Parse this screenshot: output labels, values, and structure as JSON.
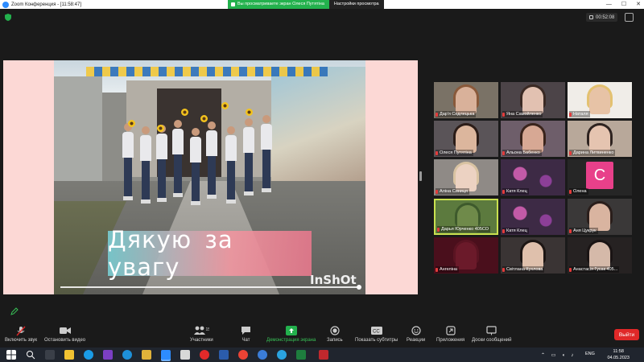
{
  "window": {
    "title": "Zoom Конференция - [11:58:47]"
  },
  "share_banner": {
    "status": "Вы просматриваете экран Олеся Путятіна",
    "settings": "Настройки просмотра"
  },
  "timer": "00:52:08",
  "slide": {
    "caption": "Дякую за увагу",
    "watermark": "InShOt"
  },
  "gallery": [
    {
      "name": "Дар'я Седлецька",
      "kind": "photo",
      "skin": "#d9b19a",
      "hair": "#8a5a3b",
      "bg": "#7a7266"
    },
    {
      "name": "Яна Самойленко",
      "kind": "photo",
      "skin": "#e2c1b1",
      "hair": "#3b2a24",
      "bg": "#4c4448"
    },
    {
      "name": "Наталя",
      "kind": "photo",
      "skin": "#e7c3a6",
      "hair": "#e3c170",
      "bg": "#f0ede8"
    },
    {
      "name": "Олеся Путятіна",
      "kind": "photo",
      "skin": "#dcb69d",
      "hair": "#2c1d18",
      "bg": "#5a5458"
    },
    {
      "name": "Альона Бабенко",
      "kind": "photo",
      "skin": "#d7a894",
      "hair": "#3a241c",
      "bg": "#6e5e6a"
    },
    {
      "name": "Дарина Литвиненко",
      "kind": "photo",
      "skin": "#e5c4b0",
      "hair": "#2e2320",
      "bg": "#b8a89a"
    },
    {
      "name": "Аліна Синиця",
      "kind": "photo",
      "skin": "#ecd2c2",
      "hair": "#d9c3a2",
      "bg": "#8f8a86"
    },
    {
      "name": "Катя Клец",
      "kind": "flower"
    },
    {
      "name": "Олена",
      "kind": "avatar",
      "letter": "C"
    },
    {
      "name": "Дарья Юрченко 405СО",
      "kind": "photo",
      "skin": "#6f8a4a",
      "hair": "#3e5a2c",
      "bg": "#5c7a3e",
      "active": true
    },
    {
      "name": "Катя Клец",
      "kind": "flower"
    },
    {
      "name": "Аня Цукрук",
      "kind": "photo",
      "skin": "#d9b4a0",
      "hair": "#2a1e1b",
      "bg": "#3a3838"
    },
    {
      "name": "Ангеліна",
      "kind": "photo",
      "skin": "#6b1a2a",
      "hair": "#5a1422",
      "bg": "#4a0f1c"
    },
    {
      "name": "Світлана Кухлова",
      "kind": "photo",
      "skin": "#dfc0ac",
      "hair": "#1d1614",
      "bg": "#3a3434"
    },
    {
      "name": "Анастасія Гусак 405...",
      "kind": "photo",
      "skin": "#d5b9a9",
      "hair": "#1a1414",
      "bg": "#262222"
    }
  ],
  "toolbar": {
    "unmute": "Включить звук",
    "stop_video": "Остановить видео",
    "participants": "Участники",
    "participants_count": "15",
    "chat": "Чат",
    "share_screen": "Демонстрация экрана",
    "record": "Запись",
    "captions": "Показать субтитры",
    "reactions": "Реакции",
    "apps": "Приложения",
    "whiteboards": "Доски сообщений",
    "leave": "Выйти"
  },
  "taskbar": {
    "lang": "ENG",
    "time": "11:58",
    "date": "04.05.2023"
  },
  "colors": {
    "zoom_blue": "#2d8cff",
    "share_green": "#23b14d",
    "leave_red": "#e02828",
    "slide_bg": "#fcd8d5"
  }
}
